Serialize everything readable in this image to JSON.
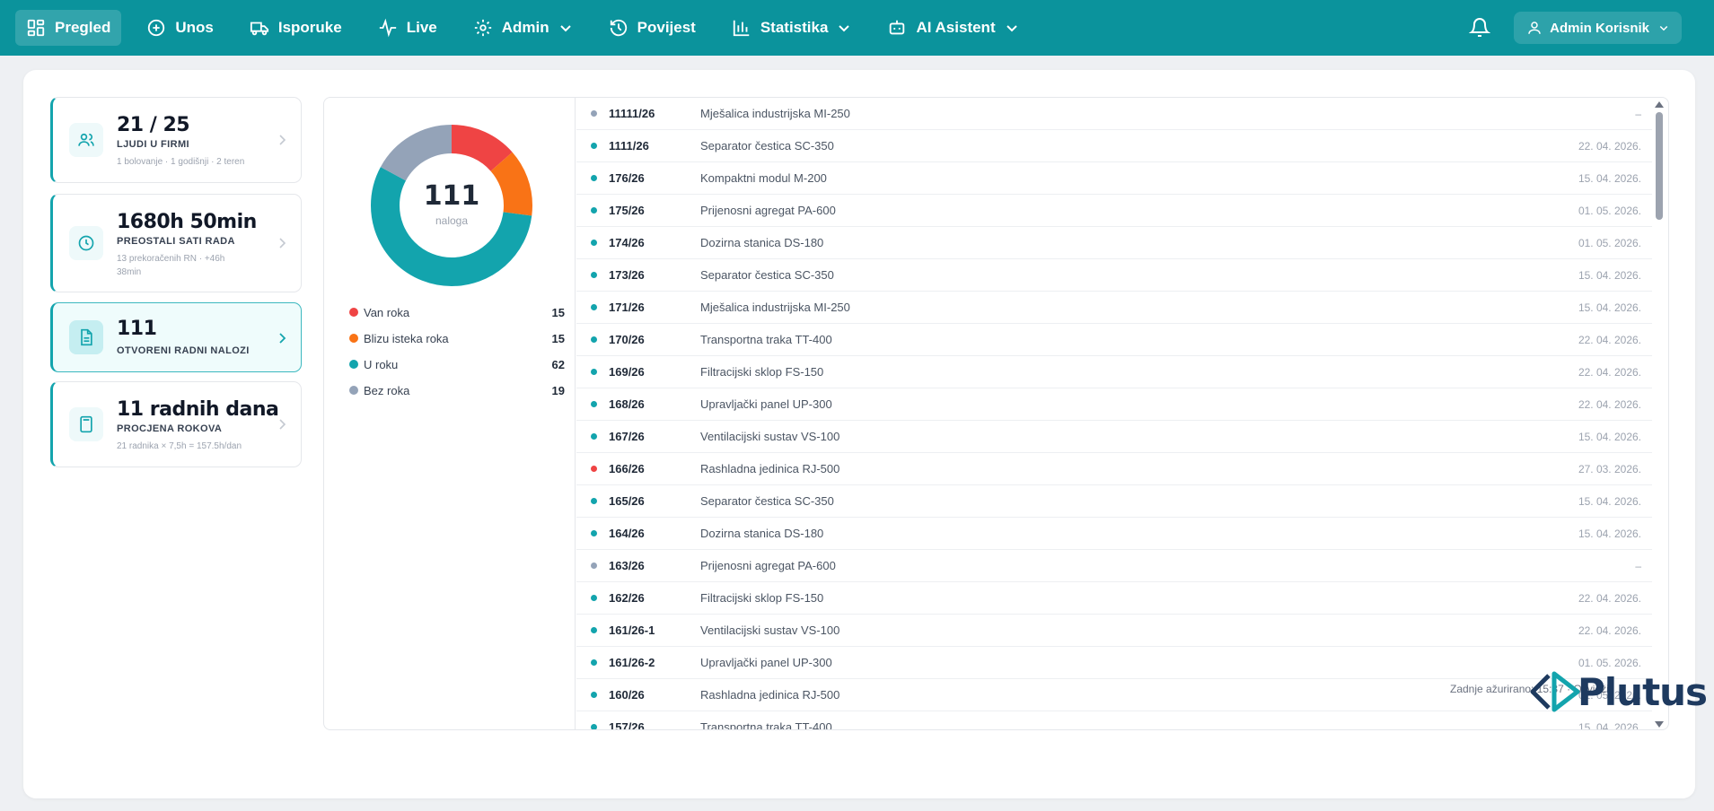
{
  "nav": {
    "items": [
      {
        "label": "Pregled",
        "icon": "dashboard-icon",
        "active": true
      },
      {
        "label": "Unos",
        "icon": "plus-circle-icon"
      },
      {
        "label": "Isporuke",
        "icon": "truck-icon"
      },
      {
        "label": "Live",
        "icon": "activity-icon"
      },
      {
        "label": "Admin",
        "icon": "gear-icon"
      },
      {
        "label": "Povijest",
        "icon": "history-icon"
      },
      {
        "label": "Statistika",
        "icon": "bar-chart-icon"
      },
      {
        "label": "AI Asistent",
        "icon": "robot-icon"
      }
    ],
    "user": "Admin Korisnik"
  },
  "cards": [
    {
      "value": "21 / 25",
      "label": "LJUDI U FIRMI",
      "sub": "1 bolovanje · 1 godišnji · 2 teren"
    },
    {
      "value": "1680h 50min",
      "label": "PREOSTALI SATI RADA",
      "sub": "13 prekoračenih RN · +46h 38min"
    },
    {
      "value": "111",
      "label": "OTVORENI RADNI NALOZI",
      "sub": ""
    },
    {
      "value": "11 radnih dana",
      "label": "PROCJENA ROKOVA",
      "sub": "21 radnika × 7,5h = 157.5h/dan"
    }
  ],
  "summary": {
    "total": "111",
    "total_label": "naloga",
    "legend": [
      {
        "label": "Van roka",
        "count": 15,
        "color": "#ef4444"
      },
      {
        "label": "Blizu isteka roka",
        "count": 15,
        "color": "#f97316"
      },
      {
        "label": "U roku",
        "count": 62,
        "color": "#13a4ad"
      },
      {
        "label": "Bez roka",
        "count": 19,
        "color": "#94a3b8"
      }
    ]
  },
  "orders": [
    {
      "id": "11111/26",
      "name": "Mješalica industrijska MI-250",
      "date": "–",
      "status": "none"
    },
    {
      "id": "1111/26",
      "name": "Separator čestica SC-350",
      "date": "22. 04. 2026.",
      "status": "ok"
    },
    {
      "id": "176/26",
      "name": "Kompaktni modul M-200",
      "date": "15. 04. 2026.",
      "status": "ok"
    },
    {
      "id": "175/26",
      "name": "Prijenosni agregat PA-600",
      "date": "01. 05. 2026.",
      "status": "ok"
    },
    {
      "id": "174/26",
      "name": "Dozirna stanica DS-180",
      "date": "01. 05. 2026.",
      "status": "ok"
    },
    {
      "id": "173/26",
      "name": "Separator čestica SC-350",
      "date": "15. 04. 2026.",
      "status": "ok"
    },
    {
      "id": "171/26",
      "name": "Mješalica industrijska MI-250",
      "date": "15. 04. 2026.",
      "status": "ok"
    },
    {
      "id": "170/26",
      "name": "Transportna traka TT-400",
      "date": "22. 04. 2026.",
      "status": "ok"
    },
    {
      "id": "169/26",
      "name": "Filtracijski sklop FS-150",
      "date": "22. 04. 2026.",
      "status": "ok"
    },
    {
      "id": "168/26",
      "name": "Upravljački panel UP-300",
      "date": "22. 04. 2026.",
      "status": "ok"
    },
    {
      "id": "167/26",
      "name": "Ventilacijski sustav VS-100",
      "date": "15. 04. 2026.",
      "status": "ok"
    },
    {
      "id": "166/26",
      "name": "Rashladna jedinica RJ-500",
      "date": "27. 03. 2026.",
      "status": "late"
    },
    {
      "id": "165/26",
      "name": "Separator čestica SC-350",
      "date": "15. 04. 2026.",
      "status": "ok"
    },
    {
      "id": "164/26",
      "name": "Dozirna stanica DS-180",
      "date": "15. 04. 2026.",
      "status": "ok"
    },
    {
      "id": "163/26",
      "name": "Prijenosni agregat PA-600",
      "date": "–",
      "status": "none"
    },
    {
      "id": "162/26",
      "name": "Filtracijski sklop FS-150",
      "date": "22. 04. 2026.",
      "status": "ok"
    },
    {
      "id": "161/26-1",
      "name": "Ventilacijski sustav VS-100",
      "date": "22. 04. 2026.",
      "status": "ok"
    },
    {
      "id": "161/26-2",
      "name": "Upravljački panel UP-300",
      "date": "01. 05. 2026.",
      "status": "ok"
    },
    {
      "id": "160/26",
      "name": "Rashladna jedinica RJ-500",
      "date": "01. 05. 2026.",
      "status": "ok"
    },
    {
      "id": "157/26",
      "name": "Transportna traka TT-400",
      "date": "15. 04. 2026.",
      "status": "ok"
    }
  ],
  "status_colors": {
    "ok": "#13a4ad",
    "late": "#ef4444",
    "none": "#94a3b8"
  },
  "footer": {
    "updated": "Zadnje ažurirano: 15:37 · Osvježi",
    "logo_text": "Plutus"
  }
}
